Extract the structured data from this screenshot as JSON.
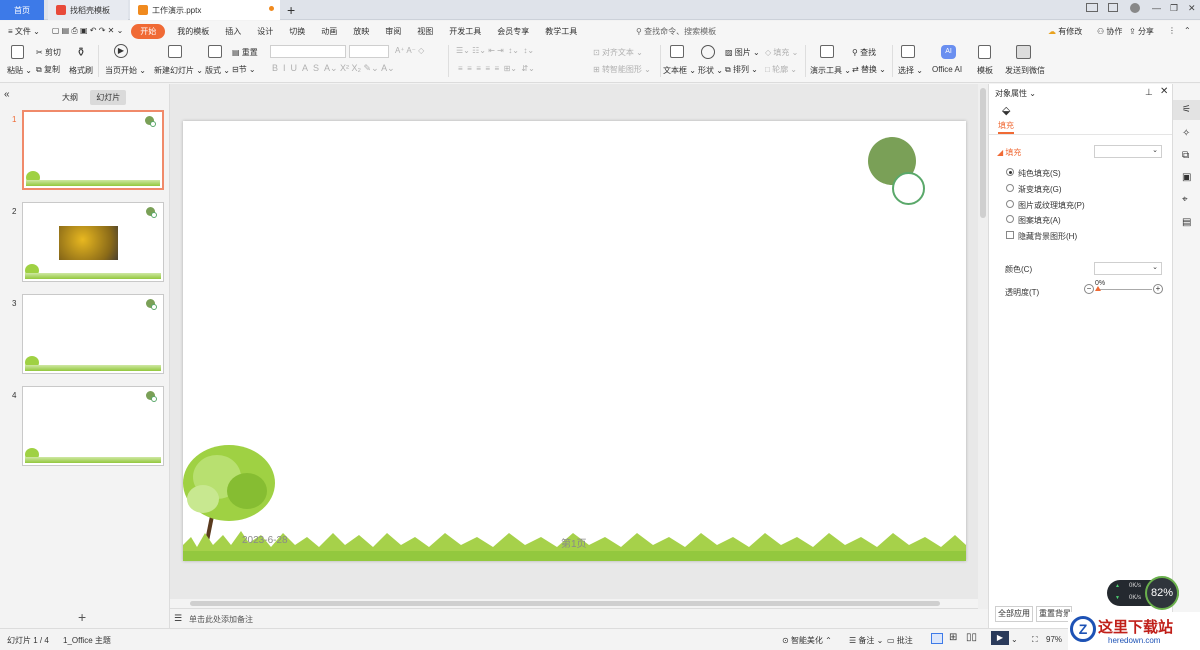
{
  "tabs": {
    "home": "首页",
    "template": "找稻壳模板",
    "document": "工作演示.pptx"
  },
  "menu": {
    "file": "文件",
    "items": [
      "开始",
      "我的模板",
      "插入",
      "设计",
      "切换",
      "动画",
      "放映",
      "审阅",
      "视图",
      "开发工具",
      "会员专享",
      "教学工具"
    ],
    "search": "查找命令、搜索模板",
    "unsaved": "有修改",
    "collab": "协作",
    "share": "分享"
  },
  "ribbon": {
    "paste": "粘贴",
    "cut": "剪切",
    "copy": "复制",
    "format_painter": "格式刷",
    "from_current": "当页开始",
    "new_slide": "新建幻灯片",
    "layout": "版式",
    "section": "节",
    "reset": "重置",
    "align_text": "对齐文本",
    "smartart": "转智能图形",
    "textbox": "文本框",
    "shape": "形状",
    "picture": "图片",
    "arrange": "排列",
    "fill": "填充",
    "outline": "轮廓",
    "present_tools": "演示工具",
    "find": "查找",
    "replace": "替换",
    "select": "选择",
    "office_ai": "Office AI",
    "template": "模板",
    "send_wechat": "发送到微信"
  },
  "left_panel": {
    "tab_outline": "大纲",
    "tab_slides": "幻灯片",
    "slide_numbers": [
      "1",
      "2",
      "3",
      "4"
    ]
  },
  "slide": {
    "date": "2023-6-28",
    "page": "第1页"
  },
  "notes_placeholder": "单击此处添加备注",
  "right_panel": {
    "title": "对象属性",
    "tab_fill": "填充",
    "section_fill": "填充",
    "options": [
      "纯色填充(S)",
      "渐变填充(G)",
      "图片或纹理填充(P)",
      "图案填充(A)"
    ],
    "hide_bg": "隐藏背景图形(H)",
    "color_label": "颜色(C)",
    "transparency_label": "透明度(T)",
    "transparency_value": "0%",
    "apply_all": "全部应用",
    "reset_bg": "重置背景"
  },
  "status": {
    "slide_count": "幻灯片 1 / 4",
    "theme": "1_Office 主题",
    "smart_beautify": "智能美化",
    "notes": "备注",
    "comments": "批注",
    "zoom": "97%"
  },
  "net_widget": {
    "up": "0K/s",
    "down": "0K/s",
    "percent": "82%"
  },
  "watermark": {
    "title": "这里下载站",
    "url": "heredown.com"
  },
  "colors": {
    "accent_orange": "#f06a35",
    "home_tab_blue": "#3d7ae8",
    "circle_green": "#7aa057",
    "grass_green": "#93c83e"
  }
}
